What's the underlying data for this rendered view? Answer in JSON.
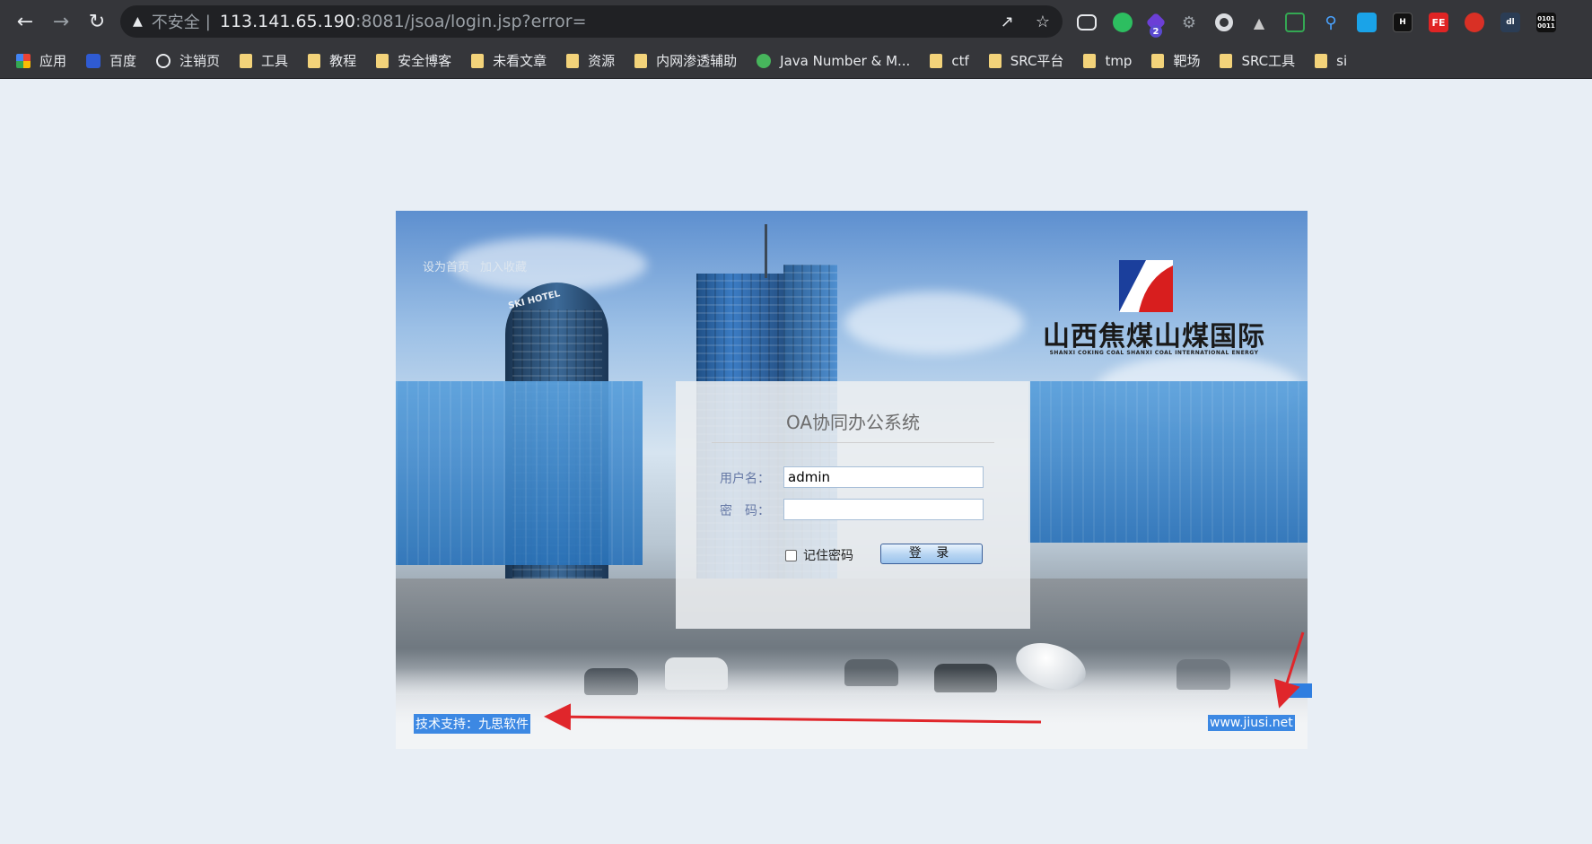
{
  "browser": {
    "security_label": "不安全",
    "url_host": "113.141.65.190",
    "url_rest": ":8081/jsoa/login.jsp?error=",
    "extension_badge": "2",
    "extensions": [
      "readlater",
      "evernote",
      "badge-ext",
      "gear",
      "circle",
      "hat",
      "terminal",
      "pin",
      "cube",
      "h",
      "FE",
      "santa",
      "dl",
      "binary"
    ],
    "extension_labels": {
      "fe": "FE",
      "binary": "0101\n0011",
      "h": "H",
      "dl": "dl"
    }
  },
  "bookmarks": [
    {
      "label": "应用",
      "icon": "apps-grid-icon"
    },
    {
      "label": "百度",
      "icon": "baidu-icon"
    },
    {
      "label": "注销页",
      "icon": "globe-icon"
    },
    {
      "label": "工具",
      "icon": "folder-icon"
    },
    {
      "label": "教程",
      "icon": "folder-icon"
    },
    {
      "label": "安全博客",
      "icon": "folder-icon"
    },
    {
      "label": "未看文章",
      "icon": "folder-icon"
    },
    {
      "label": "资源",
      "icon": "folder-icon"
    },
    {
      "label": "内网渗透辅助",
      "icon": "folder-icon"
    },
    {
      "label": "Java Number & M...",
      "icon": "green-site-icon"
    },
    {
      "label": "ctf",
      "icon": "folder-icon"
    },
    {
      "label": "SRC平台",
      "icon": "folder-icon"
    },
    {
      "label": "tmp",
      "icon": "folder-icon"
    },
    {
      "label": "靶场",
      "icon": "folder-icon"
    },
    {
      "label": "SRC工具",
      "icon": "folder-icon"
    },
    {
      "label": "si",
      "icon": "folder-icon"
    }
  ],
  "page": {
    "top_links": [
      "设为首页",
      "加入收藏"
    ],
    "logo_text": "山西焦煤山煤国际",
    "logo_subtext": "SHANXI COKING COAL SHANXI COAL INTERNATIONAL ENERGY",
    "hotel_sign": "SKI HOTEL",
    "login": {
      "title": "OA协同办公系统",
      "username_label": "用户名：",
      "username_value": "admin",
      "password_label": "密　码：",
      "password_value": "",
      "remember_label": "记住密码",
      "submit_label": "登 录"
    },
    "tech_support": "技术支持：九思软件",
    "site_link": "www.jiusi.net"
  },
  "colors": {
    "arrow": "#e0262b",
    "highlight": "#3c88e3",
    "chrome": "#35363a"
  }
}
